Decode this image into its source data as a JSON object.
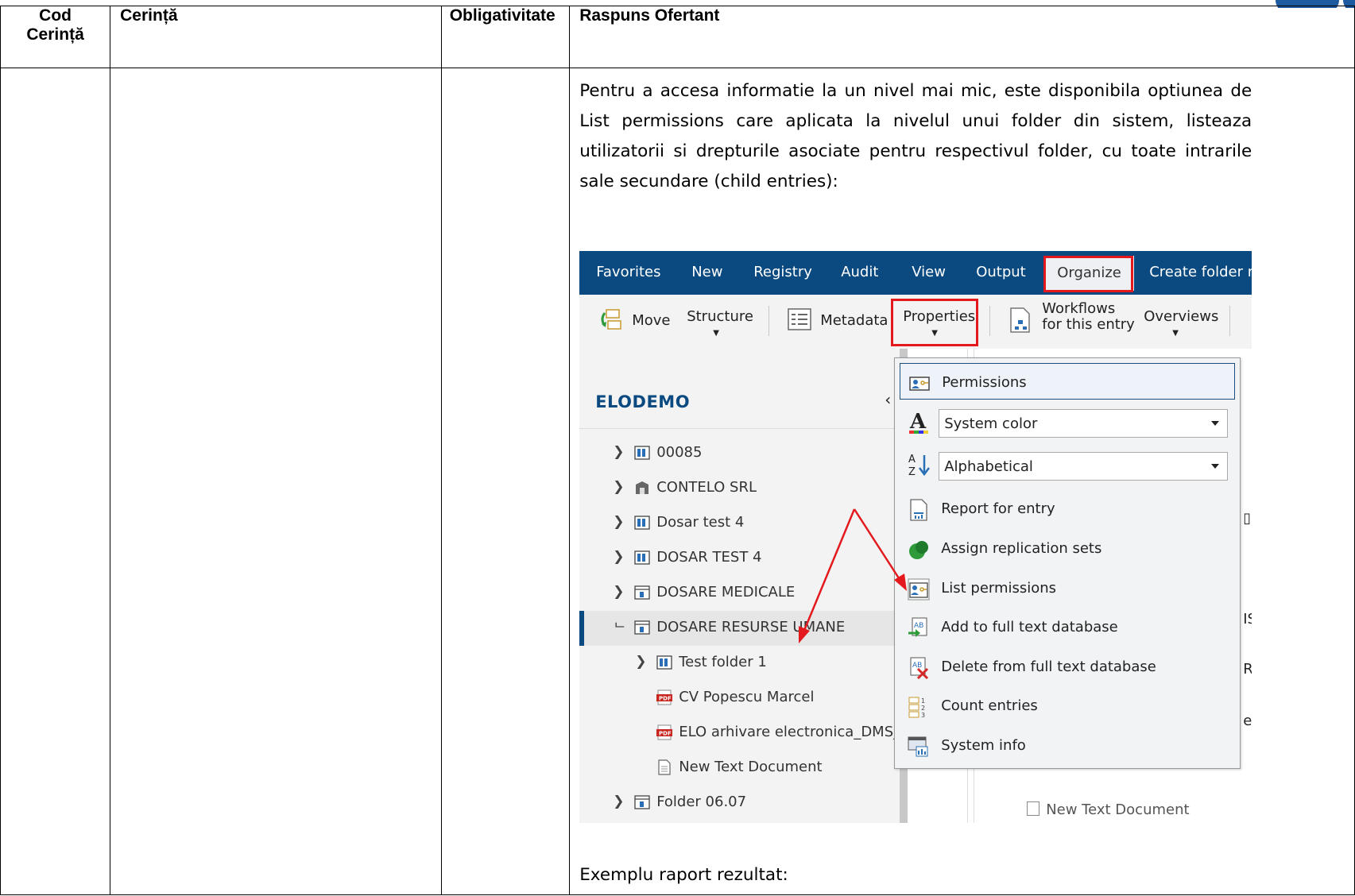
{
  "table": {
    "headers": [
      "Cod Cerință",
      "Cerință",
      "Obligativitate",
      "Raspuns Ofertant"
    ],
    "header_code_line1": "Cod",
    "header_code_line2": "Cerință",
    "response": {
      "paragraph": "Pentru a accesa informatie la un nivel mai mic, este disponibila optiunea de List permissions care aplicata la nivelul unui folder din sistem, listeaza utilizatorii si drepturile asociate pentru respectivul folder, cu toate intrarile sale secundare (child entries):",
      "example_label": "Exemplu raport rezultat:"
    }
  },
  "screenshot": {
    "top_tabs": [
      "Favorites",
      "New",
      "Registry",
      "Audit",
      "View",
      "Output",
      "Organize",
      "Create folder re"
    ],
    "active_tab": "Organize",
    "toolbar": {
      "move": "Move",
      "structure": "Structure",
      "metadata": "Metadata",
      "properties": "Properties",
      "workflows_line1": "Workflows",
      "workflows_line2": "for this entry",
      "overviews": "Overviews"
    },
    "repository_title": "ELODEMO",
    "tree": [
      {
        "label": "00085",
        "icon": "folder-binder-icon",
        "expander": ">"
      },
      {
        "label": "CONTELO SRL",
        "icon": "cabinet-icon",
        "expander": ">"
      },
      {
        "label": "Dosar test 4",
        "icon": "folder-binder-icon",
        "expander": ">"
      },
      {
        "label": "DOSAR TEST 4",
        "icon": "folder-binder-icon",
        "expander": ">"
      },
      {
        "label": "DOSARE MEDICALE",
        "icon": "register-icon",
        "expander": ">"
      },
      {
        "label": "DOSARE RESURSE UMANE",
        "icon": "register-icon",
        "expander": "⌐",
        "selected": true
      },
      {
        "label": "Test folder 1",
        "icon": "folder-binder-icon",
        "expander": ">"
      },
      {
        "label": "CV Popescu Marcel",
        "icon": "pdf-icon",
        "expander": ""
      },
      {
        "label": "ELO arhivare electronica_DMS_",
        "icon": "pdf-icon",
        "expander": ""
      },
      {
        "label": "New Text Document",
        "icon": "text-document-icon",
        "expander": ""
      },
      {
        "label": "Folder 06.07",
        "icon": "register-icon",
        "expander": ">"
      }
    ],
    "menu": {
      "permissions": "Permissions",
      "color_select": "System color",
      "sort_select": "Alphabetical",
      "items": [
        {
          "label": "Report for entry",
          "icon": "report-icon"
        },
        {
          "label": "Assign replication sets",
          "icon": "replication-icon"
        },
        {
          "label": "List permissions",
          "icon": "list-permissions-icon"
        },
        {
          "label": "Add to full text database",
          "icon": "add-fulltext-icon"
        },
        {
          "label": "Delete from full text database",
          "icon": "delete-fulltext-icon"
        },
        {
          "label": "Count entries",
          "icon": "count-entries-icon"
        },
        {
          "label": "System info",
          "icon": "system-info-icon"
        }
      ]
    },
    "background_panel_text": "New Text Document",
    "colors": {
      "topbar": "#0a4a80",
      "highlight_box": "#e3191e",
      "arrow": "#e3191e",
      "tree_title": "#0a4a80"
    }
  }
}
